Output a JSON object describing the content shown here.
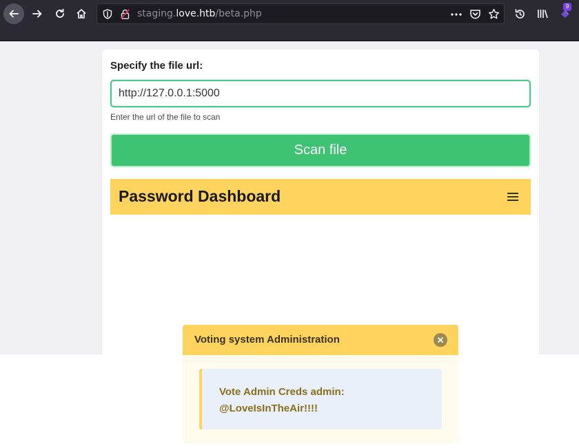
{
  "browser": {
    "url_prefix": "staging.",
    "url_host": "love.htb",
    "url_path": "/beta.php",
    "extensions_badge": "9",
    "icons": [
      "back-arrow-icon",
      "forward-arrow-icon",
      "reload-icon",
      "home-icon",
      "shield-icon",
      "insecure-lock-icon",
      "more-dots-icon",
      "pocket-icon",
      "bookmark-star-icon",
      "history-icon",
      "library-icon",
      "extensions-icon"
    ]
  },
  "form": {
    "label": "Specify the file url:",
    "url_value": "http://127.0.0.1:5000",
    "help_text": "Enter the url of the file to scan",
    "scan_button_label": "Scan file"
  },
  "dashboard": {
    "title": "Password Dashboard"
  },
  "notification": {
    "title": "Voting system Administration",
    "message": "Vote Admin Creds admin: @LoveIsInTheAir!!!!"
  },
  "colors": {
    "toolbar_bg": "#2b2a33",
    "accent_green": "#3ec372",
    "input_border": "#48c78e",
    "navbar_yellow": "#fed45f",
    "message_text": "#8a6d1d"
  }
}
